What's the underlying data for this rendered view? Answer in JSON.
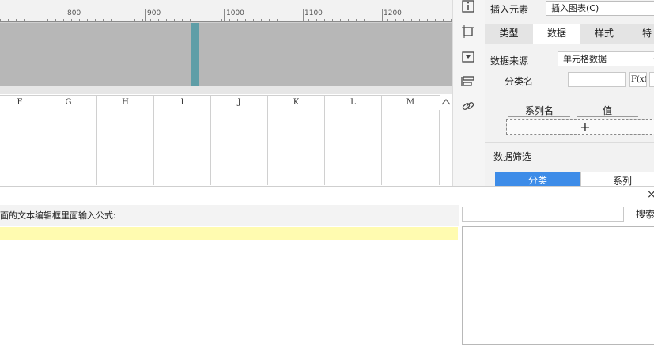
{
  "ruler": {
    "labels": [
      "800",
      "900",
      "1000",
      "1100",
      "1200"
    ]
  },
  "sheet": {
    "columns": [
      "F",
      "G",
      "H",
      "I",
      "J",
      "K",
      "L",
      "M"
    ]
  },
  "panel": {
    "insert_label": "插入元素",
    "insert_value": "插入图表(C)",
    "tabs": [
      "类型",
      "数据",
      "样式",
      "特效"
    ],
    "active_tab_index": 1,
    "data_source_label": "数据来源",
    "data_source_value": "单元格数据",
    "category_label": "分类名",
    "fx_label": "F(x)",
    "series_name_header": "系列名",
    "value_header": "值",
    "add_symbol": "+",
    "data_filter_label": "数据筛选",
    "filter_tabs": [
      "分类",
      "系列"
    ],
    "colors": {
      "active_tab_bg": "#ffffff",
      "filter_active": "#3d8ce8"
    }
  },
  "formula": {
    "hint": "面的文本编辑框里面输入公式:",
    "search_button": "搜索",
    "close": "×"
  },
  "icons": [
    "info-icon",
    "frame-icon",
    "dropdown-icon",
    "layer-icon",
    "link-icon"
  ]
}
